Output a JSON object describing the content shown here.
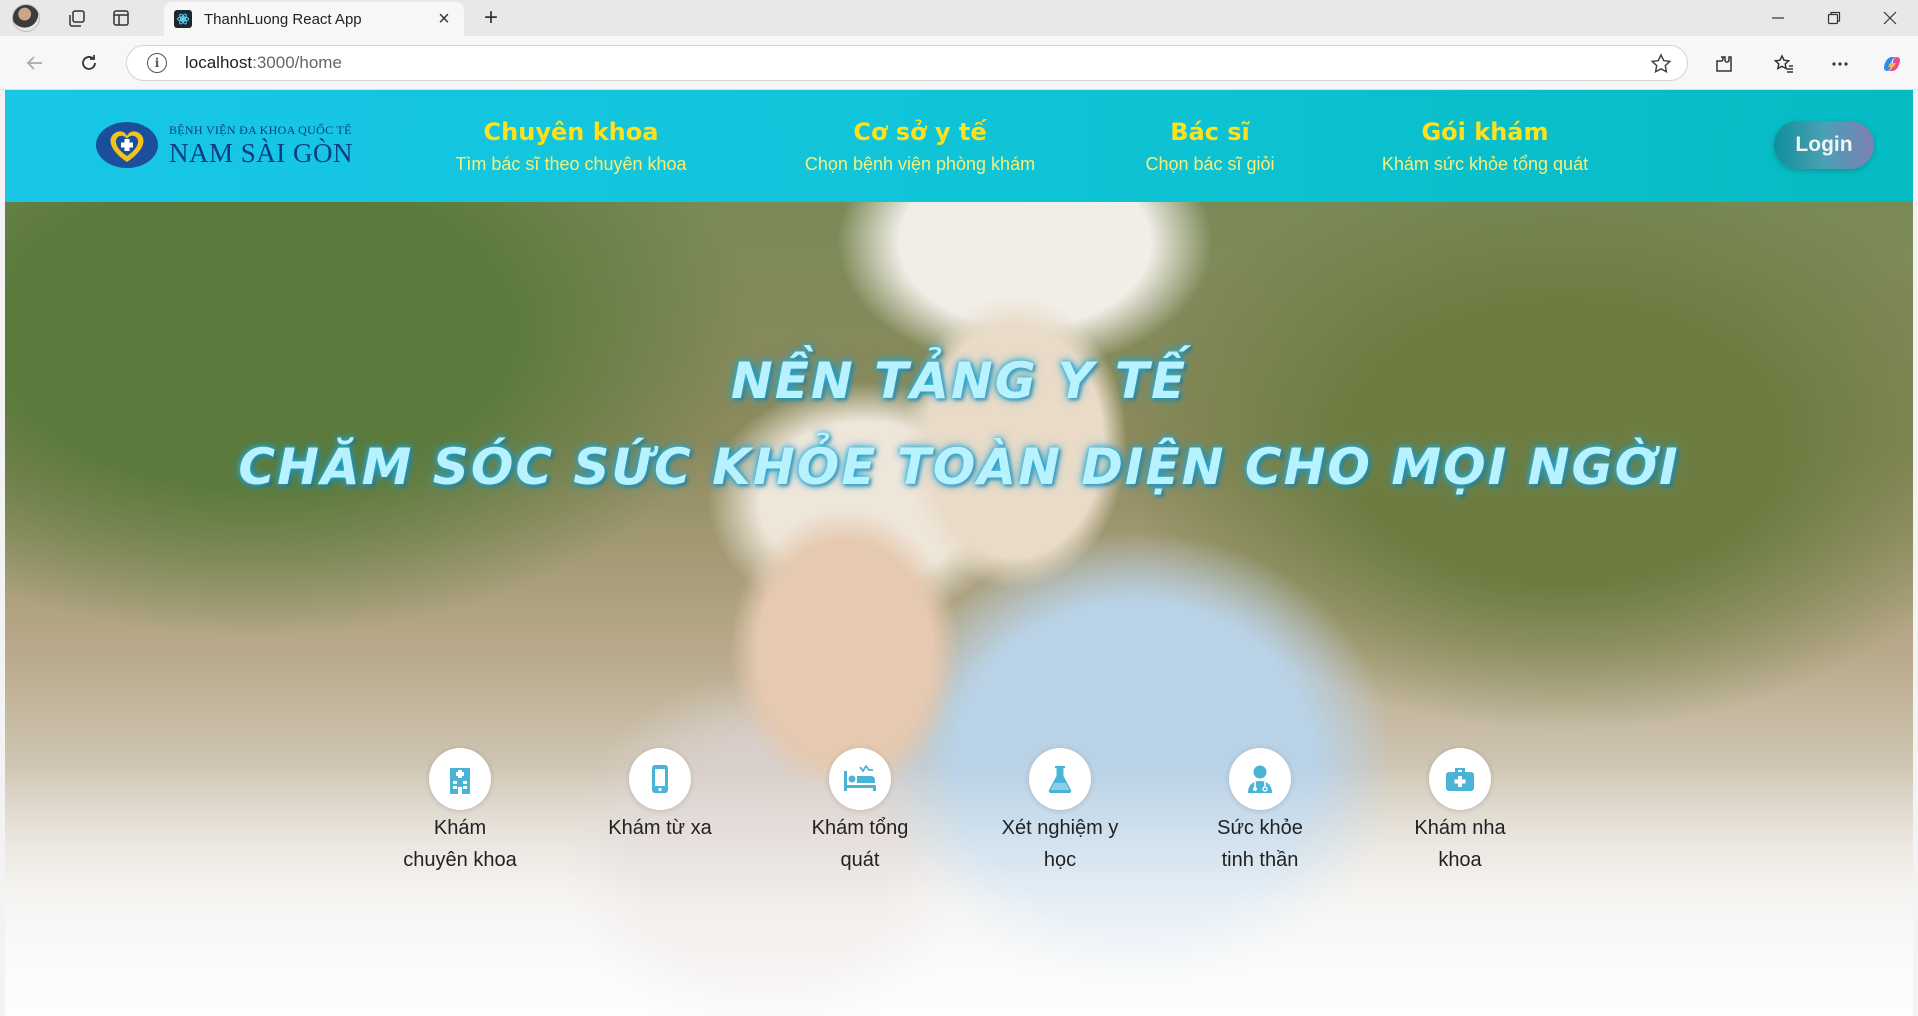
{
  "browser": {
    "tab_title": "ThanhLuong React App",
    "url_host": "localhost",
    "url_path": ":3000/home"
  },
  "site": {
    "logo_small": "BỆNH VIỆN ĐA KHOA QUỐC TẾ",
    "logo_big": "NAM SÀI GÒN",
    "nav": [
      {
        "title": "Chuyên khoa",
        "subtitle": "Tìm bác sĩ theo chuyên khoa"
      },
      {
        "title": "Cơ sở y tế",
        "subtitle": "Chọn bệnh viện phòng khám"
      },
      {
        "title": "Bác sĩ",
        "subtitle": "Chọn bác sĩ giỏi"
      },
      {
        "title": "Gói khám",
        "subtitle": "Khám sức khỏe tổng quát"
      }
    ],
    "login_label": "Login"
  },
  "hero": {
    "line1": "NỀN TẢNG Y TẾ",
    "line2": "CHĂM SÓC SỨC KHỎE TOÀN DIỆN CHO MỌI NGỜI",
    "services": [
      {
        "icon": "hospital-building-icon",
        "line1": "Khám",
        "line2": "chuyên khoa"
      },
      {
        "icon": "mobile-phone-icon",
        "line1": "Khám từ xa",
        "line2": ""
      },
      {
        "icon": "hospital-bed-icon",
        "line1": "Khám tổng",
        "line2": "quát"
      },
      {
        "icon": "flask-icon",
        "line1": "Xét nghiệm y",
        "line2": "học"
      },
      {
        "icon": "doctor-icon",
        "line1": "Sức khỏe",
        "line2": "tinh thần"
      },
      {
        "icon": "medical-kit-icon",
        "line1": "Khám nha",
        "line2": "khoa"
      }
    ]
  },
  "colors": {
    "header_gradient_start": "#18c6e6",
    "header_gradient_end": "#05bbc2",
    "nav_title": "#ffe11a",
    "icon_accent": "#49b4d6",
    "headline": "#b8f2ff"
  }
}
